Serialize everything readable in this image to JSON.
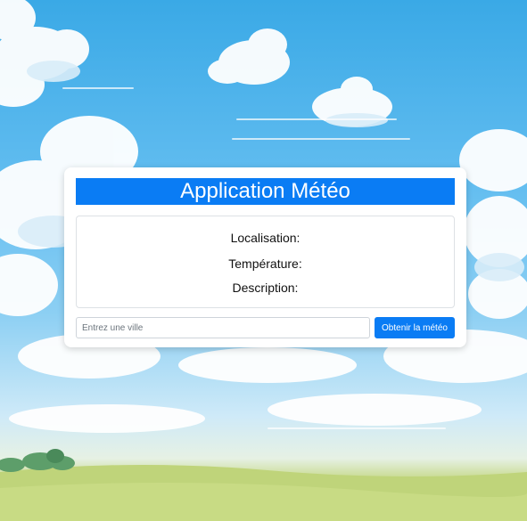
{
  "app": {
    "title": "Application Météo"
  },
  "weather": {
    "location_label": "Localisation:",
    "temperature_label": "Température:",
    "description_label": "Description:"
  },
  "form": {
    "city_placeholder": "Entrez une ville",
    "city_value": "",
    "submit_label": "Obtenir la météo"
  },
  "colors": {
    "primary": "#0a7cf4",
    "sky": "#62bdf0",
    "grass": "#b9cf6e"
  }
}
